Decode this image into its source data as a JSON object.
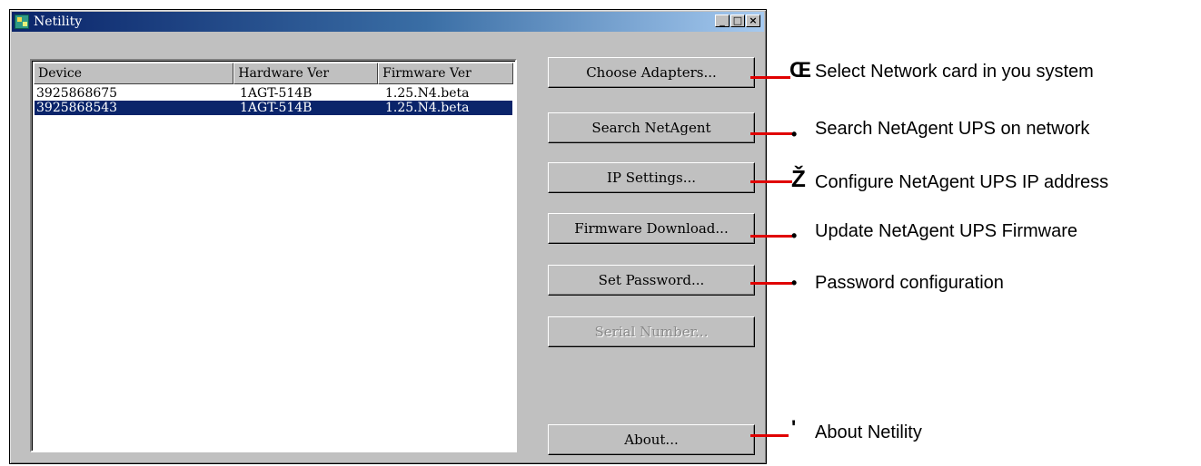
{
  "window": {
    "title": "Netility",
    "controls": {
      "minimize": "_",
      "maximize": "□",
      "close": "×"
    }
  },
  "list": {
    "columns": [
      "Device",
      "Hardware Ver",
      "Firmware Ver"
    ],
    "rows": [
      {
        "device": "3925868675",
        "hardware": "1AGT-514B",
        "firmware": "1.25.N4.beta",
        "selected": false
      },
      {
        "device": "3925868543",
        "hardware": "1AGT-514B",
        "firmware": "1.25.N4.beta",
        "selected": true
      }
    ]
  },
  "buttons": {
    "choose_adapters": "Choose Adapters...",
    "search": "Search NetAgent",
    "ip_settings": "IP Settings...",
    "firmware_download": "Firmware Download...",
    "set_password": "Set Password...",
    "serial_number": "Serial Number...",
    "about": "About..."
  },
  "annotations": [
    {
      "marker": "Œ",
      "text": "Select Network card in you system"
    },
    {
      "marker": "•",
      "text": "Search NetAgent UPS on network"
    },
    {
      "marker": "Ž",
      "text": "Configure NetAgent UPS IP address"
    },
    {
      "marker": "•",
      "text": "Update NetAgent UPS Firmware"
    },
    {
      "marker": "•",
      "text": "Password configuration"
    },
    {
      "marker": "'",
      "text": "About Netility"
    }
  ],
  "colors": {
    "title_bar": "#0a246a",
    "selection": "#0a246a",
    "connector": "#e00000",
    "face": "#c0c0c0"
  }
}
